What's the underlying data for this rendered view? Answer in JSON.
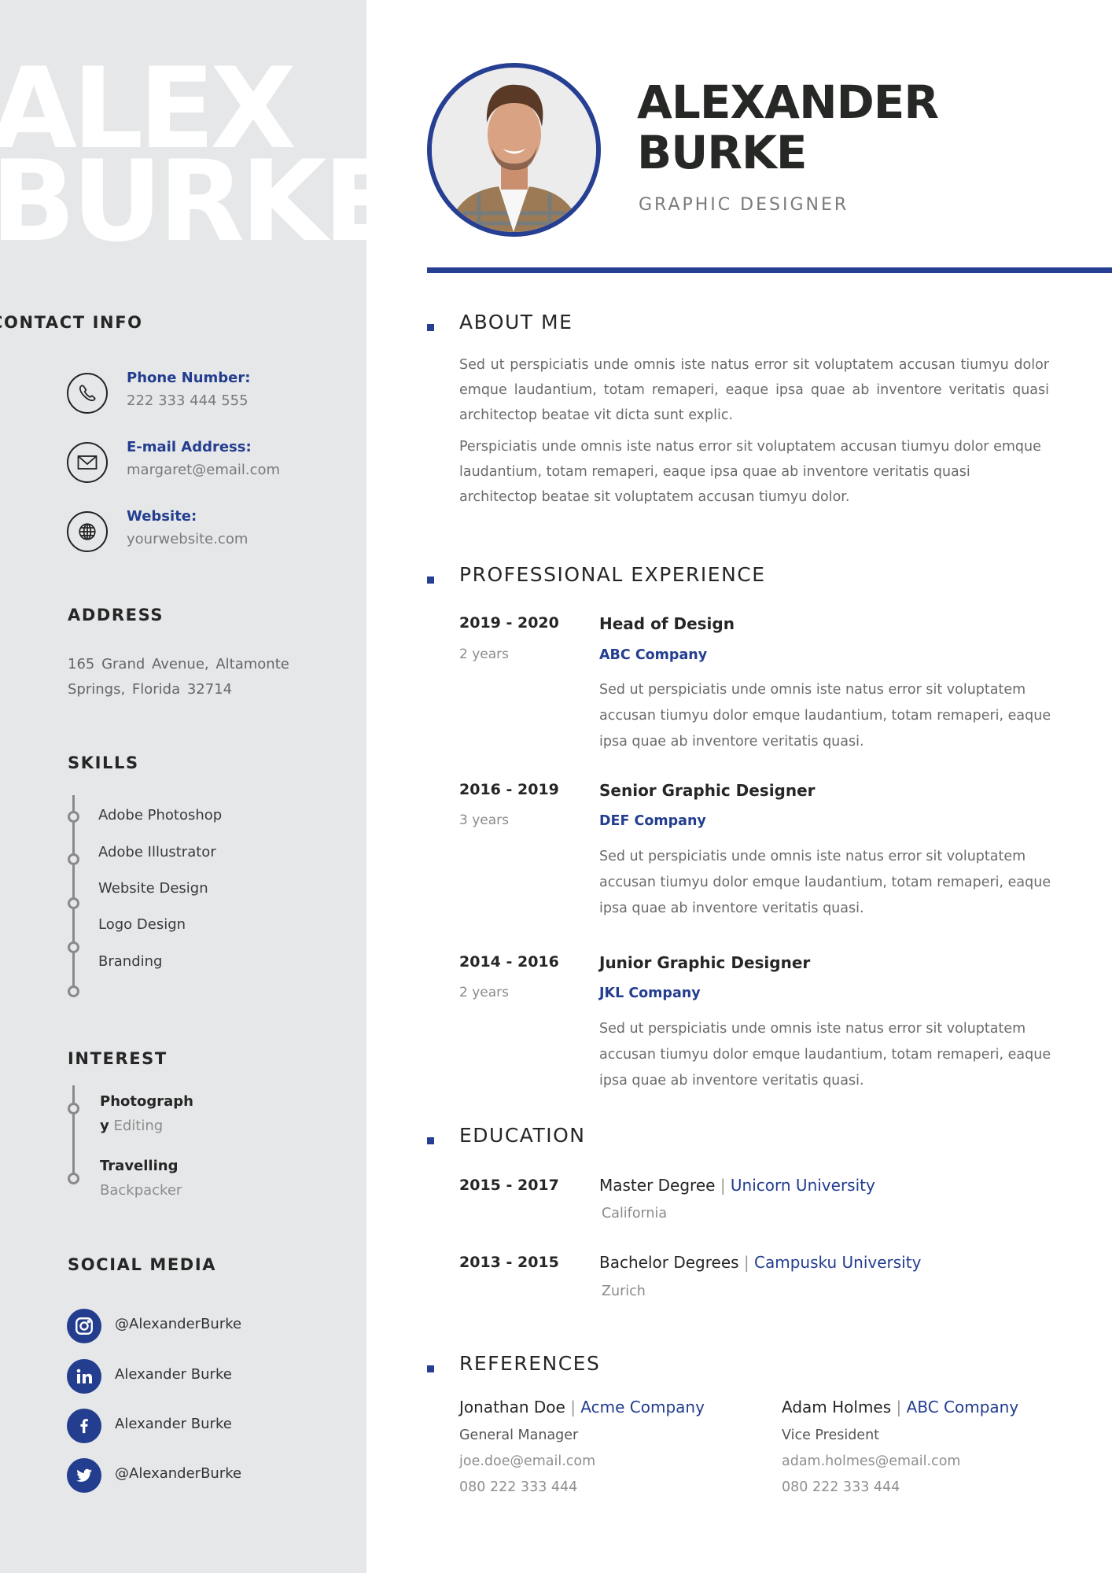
{
  "colors": {
    "accent": "#263f92",
    "sidebar_bg": "#e6e7e9",
    "heading": "#262626",
    "muted": "#7a7a7a"
  },
  "sidebar": {
    "bg_name": {
      "line1": "ALEX",
      "line2": "BURKE"
    },
    "contact": {
      "heading": "CONTACT INFO",
      "items": [
        {
          "icon": "phone-icon",
          "label": "Phone  Number:",
          "value": "222 333 444 555"
        },
        {
          "icon": "mail-icon",
          "label": "E-mail Address:",
          "value": "margaret@email.com"
        },
        {
          "icon": "globe-icon",
          "label": "Website:",
          "value": "yourwebsite.com"
        }
      ]
    },
    "address": {
      "heading": "ADDRESS",
      "text": "165  Grand  Avenue,  Altamonte Springs, Florida 32714"
    },
    "skills": {
      "heading": "SKILLS",
      "items": [
        "Adobe Photoshop",
        "Adobe Illustrator",
        "Website Design",
        "Logo Design",
        "Branding"
      ]
    },
    "interest": {
      "heading": "INTEREST",
      "items": [
        {
          "title_line1": "Photograph",
          "title_line2": "y",
          "sub": "Editing"
        },
        {
          "title_line1": "Travelling",
          "sub": "Backpacker"
        }
      ]
    },
    "social": {
      "heading": "SOCIAL MEDIA",
      "items": [
        {
          "icon": "instagram-icon",
          "text": "@AlexanderBurke"
        },
        {
          "icon": "linkedin-icon",
          "text": "Alexander Burke"
        },
        {
          "icon": "facebook-icon",
          "text": "Alexander Burke"
        },
        {
          "icon": "twitter-icon",
          "text": "@AlexanderBurke"
        }
      ]
    }
  },
  "header": {
    "name_line1": "ALEXANDER",
    "name_line2": "BURKE",
    "role": "GRAPHIC DESIGNER",
    "photo": "profile-photo"
  },
  "about": {
    "heading": "ABOUT ME",
    "paragraphs": [
      "Sed ut perspiciatis unde omnis iste natus error sit voluptatem accusan tiumyu dolor emque laudantium, totam remaperi, eaque ipsa quae ab inventore veritatis quasi architectop beatae vit dicta sunt explic.",
      "Perspiciatis unde omnis iste natus error sit voluptatem accusan tiumyu dolor emque laudantium, totam remaperi, eaque ipsa quae ab inventore veritatis quasi architectop beatae sit voluptatem accusan tiumyu dolor."
    ]
  },
  "experience": {
    "heading": "PROFESSIONAL EXPERIENCE",
    "items": [
      {
        "years": "2019 - 2020",
        "duration": "2 years",
        "title": "Head of Design",
        "company": "ABC Company",
        "desc": "Sed ut perspiciatis unde omnis iste natus error sit voluptatem accusan tiumyu dolor emque laudantium, totam remaperi, eaque ipsa quae ab inventore veritatis quasi."
      },
      {
        "years": "2016 - 2019",
        "duration": "3 years",
        "title": "Senior Graphic Designer",
        "company": "DEF Company",
        "desc": "Sed ut perspiciatis unde omnis iste natus error sit voluptatem accusan tiumyu dolor emque laudantium, totam remaperi, eaque ipsa quae ab inventore veritatis quasi."
      },
      {
        "years": "2014 - 2016",
        "duration": "2 years",
        "title": "Junior Graphic Designer",
        "company": "JKL Company",
        "desc": "Sed ut perspiciatis unde omnis iste natus error sit voluptatem accusan tiumyu dolor emque laudantium, totam remaperi, eaque ipsa quae ab inventore veritatis quasi."
      }
    ]
  },
  "education": {
    "heading": "EDUCATION",
    "items": [
      {
        "years": "2015 - 2017",
        "degree": "Master Degree",
        "separator": "|",
        "university": "Unicorn University",
        "location": "California"
      },
      {
        "years": "2013 - 2015",
        "degree": "Bachelor Degrees",
        "separator": "|",
        "university": "Campusku University",
        "location": "Zurich"
      }
    ]
  },
  "references": {
    "heading": "REFERENCES",
    "items": [
      {
        "name": "Jonathan Doe",
        "separator": "|",
        "company": "Acme Company",
        "role": "General Manager",
        "email": "joe.doe@email.com",
        "phone": "080 222 333 444"
      },
      {
        "name": "Adam Holmes",
        "separator": "|",
        "company": "ABC Company",
        "role": "Vice President",
        "email": "adam.holmes@email.com",
        "phone": "080 222 333 444"
      }
    ]
  }
}
